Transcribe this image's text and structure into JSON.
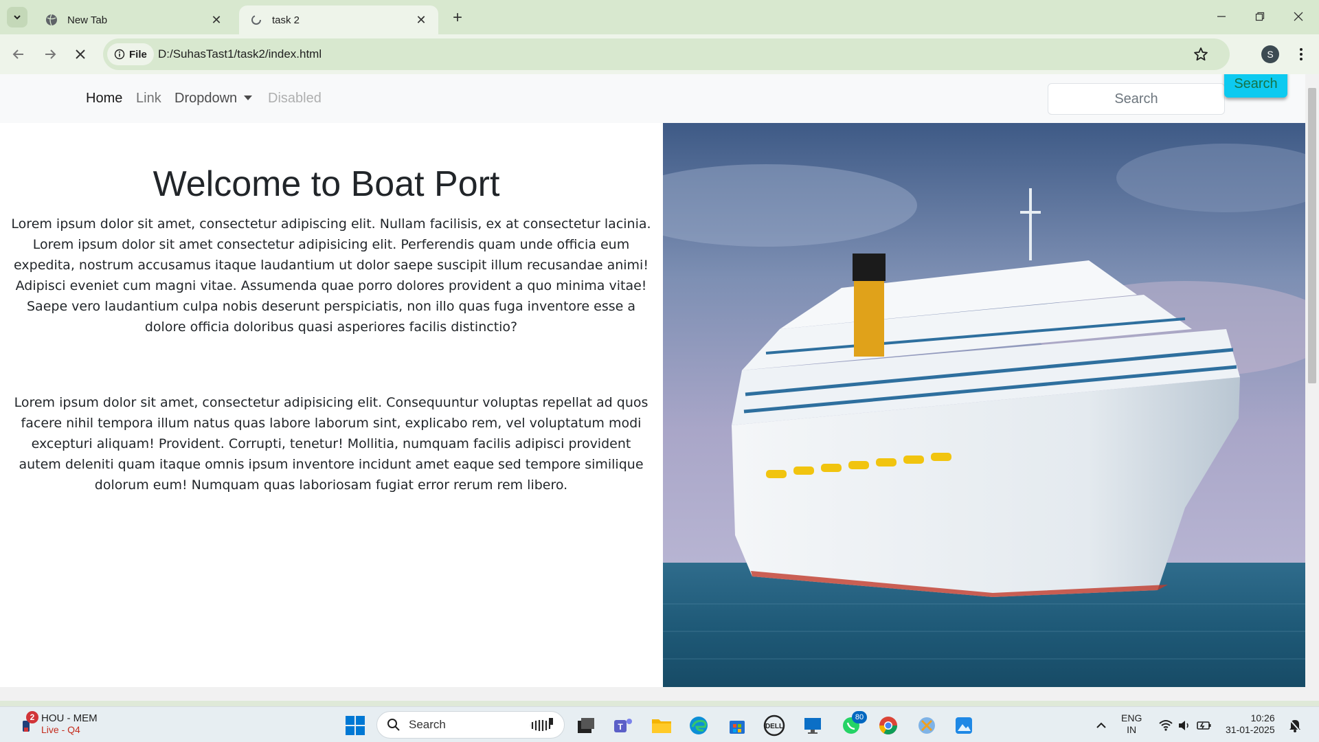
{
  "browser": {
    "tabs": [
      {
        "title": "New Tab",
        "icon": "globe-icon",
        "active": false
      },
      {
        "title": "task 2",
        "icon": "loading-icon",
        "active": true
      }
    ],
    "new_tab": "+",
    "site_chip": "File",
    "url": "D:/SuhasTast1/task2/index.html",
    "profile_initial": "S"
  },
  "navbar": {
    "links": [
      {
        "label": "Home",
        "state": "active"
      },
      {
        "label": "Link",
        "state": "normal"
      },
      {
        "label": "Dropdown",
        "state": "dropdown"
      },
      {
        "label": "Disabled",
        "state": "disabled"
      }
    ],
    "search_placeholder": "Search",
    "search_button": "Search"
  },
  "hero": {
    "title": "Welcome to Boat Port",
    "paragraph1": "Lorem ipsum dolor sit amet, consectetur adipiscing elit. Nullam facilisis, ex at consectetur lacinia. Lorem ipsum dolor sit amet consectetur adipisicing elit. Perferendis quam unde officia eum expedita, nostrum accusamus itaque laudantium ut dolor saepe suscipit illum recusandae animi! Adipisci eveniet cum magni vitae. Assumenda quae porro dolores provident a quo minima vitae! Saepe vero laudantium culpa nobis deserunt perspiciatis, non illo quas fuga inventore esse a dolore officia doloribus quasi asperiores facilis distinctio?",
    "paragraph2": "Lorem ipsum dolor sit amet, consectetur adipisicing elit. Consequuntur voluptas repellat ad quos facere nihil tempora illum natus quas labore laborum sint, explicabo rem, vel voluptatum modi excepturi aliquam! Provident. Corrupti, tenetur! Mollitia, numquam facilis adipisci provident autem deleniti quam itaque omnis ipsum inventore incidunt amet eaque sed tempore similique dolorum eum! Numquam quas laboriosam fugiat error rerum rem libero.",
    "image": "cruise-ship-photo"
  },
  "taskbar": {
    "widget_badge": "2",
    "widget_line1": "HOU - MEM",
    "widget_line2": "Live - Q4",
    "search_label": "Search",
    "whatsapp_badge": "80",
    "language_line1": "ENG",
    "language_line2": "IN",
    "time": "10:26",
    "date": "31-01-2025"
  },
  "colors": {
    "tabbar": "#d8e8cf",
    "toolbar": "#eef4ea",
    "navbar_bg": "#f8f9fa",
    "search_button_bg": "#0dcaf0",
    "search_button_text": "#157347"
  }
}
